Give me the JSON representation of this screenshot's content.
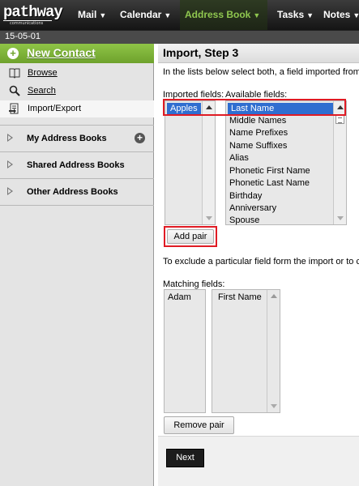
{
  "header": {
    "logo_text": "pathway",
    "logo_sub": "communications",
    "nav": [
      {
        "label": "Mail",
        "active": false
      },
      {
        "label": "Calendar",
        "active": false
      },
      {
        "label": "Address Book",
        "active": true
      },
      {
        "label": "Tasks",
        "active": false
      },
      {
        "label": "Notes",
        "active": false
      }
    ],
    "date": "15-05-01"
  },
  "sidebar": {
    "new_contact": "New Contact",
    "items": [
      {
        "label": "Browse",
        "icon": "book-icon"
      },
      {
        "label": "Search",
        "icon": "search-icon"
      },
      {
        "label": "Import/Export",
        "icon": "import-export-icon",
        "selected": true
      }
    ],
    "groups": [
      {
        "label": "My Address Books",
        "has_add": true
      },
      {
        "label": "Shared Address Books",
        "has_add": false
      },
      {
        "label": "Other Address Books",
        "has_add": false
      }
    ]
  },
  "main": {
    "title": "Import, Step 3",
    "instruction": "In the lists below select both, a field imported from",
    "imported_label": "Imported fields:",
    "available_label": "Available fields:",
    "imported_fields": [
      "Apples"
    ],
    "available_fields": [
      "Last Name",
      "Middle Names",
      "Name Prefixes",
      "Name Suffixes",
      "Alias",
      "Phonetic First Name",
      "Phonetic Last Name",
      "Birthday",
      "Anniversary",
      "Spouse"
    ],
    "add_pair": "Add pair",
    "exclude_text": "To exclude a particular field form the import or to c",
    "matching_label": "Matching fields:",
    "matching_left": [
      "Adam"
    ],
    "matching_right": [
      "First Name"
    ],
    "remove_pair": "Remove pair",
    "next": "Next"
  },
  "colors": {
    "accent_green": "#7fb53a",
    "highlight_blue": "#2f6ed0",
    "annotation_red": "#e01b24"
  }
}
